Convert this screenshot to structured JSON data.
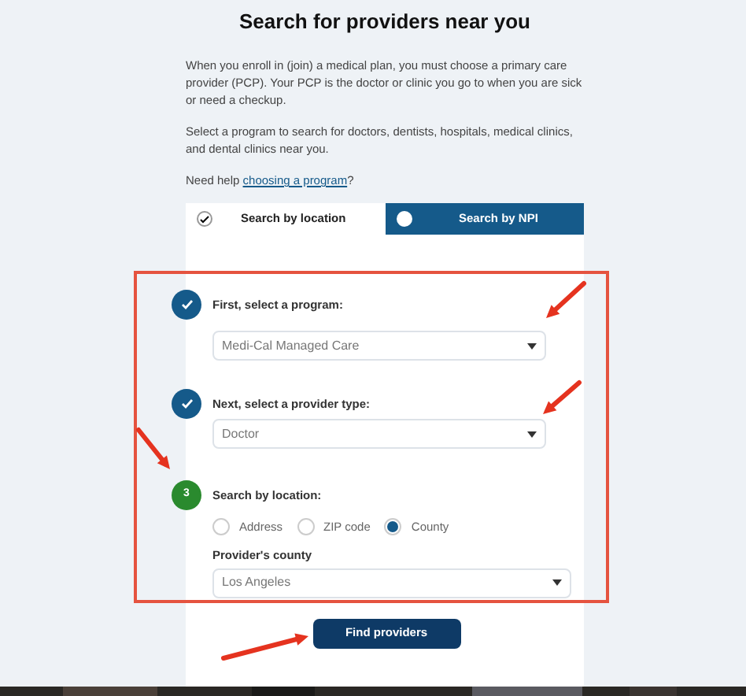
{
  "title": "Search for providers near you",
  "paragraphs": [
    "When you enroll in (join) a medical plan, you must choose a primary care provider (PCP). Your PCP is the doctor or clinic you go to when you are sick or need a checkup.",
    "Select a program to search for doctors, dentists, hospitals, medical clinics, and dental clinics near you."
  ],
  "help": {
    "text": "Need help ",
    "link": "choosing a program",
    "after": "?"
  },
  "tabs": [
    {
      "label": "Search by location",
      "selected": true
    },
    {
      "label": "Search by NPI",
      "selected": false
    }
  ],
  "steps": [
    {
      "kind": "done",
      "label": "First, select a program:",
      "select": "Medi-Cal Managed Care"
    },
    {
      "kind": "done",
      "label": "Next, select a provider type:",
      "select": "Doctor"
    },
    {
      "kind": "number",
      "number": "3",
      "label": "Search by location:",
      "radios": [
        {
          "label": "Address",
          "selected": false
        },
        {
          "label": "ZIP code",
          "selected": false
        },
        {
          "label": "County",
          "selected": true
        }
      ],
      "field_label": "Provider's county",
      "select": "Los Angeles"
    }
  ],
  "button": "Find providers"
}
